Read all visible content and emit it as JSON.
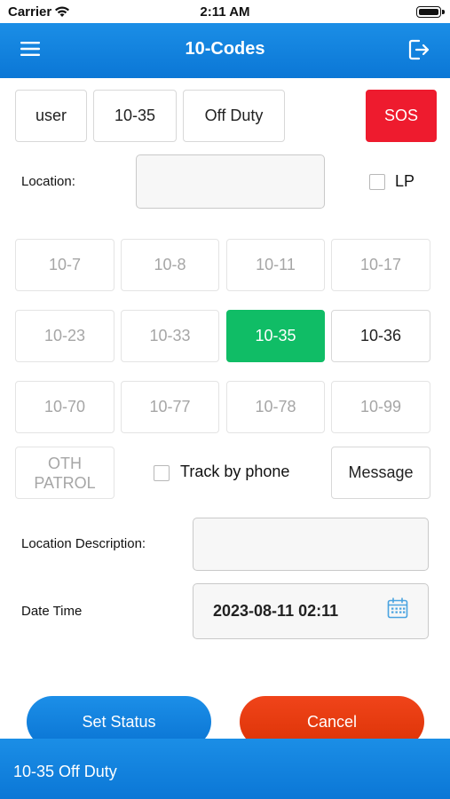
{
  "status_bar": {
    "carrier": "Carrier",
    "time": "2:11 AM"
  },
  "header": {
    "title": "10-Codes"
  },
  "top_row": {
    "user": "user",
    "code": "10-35",
    "duty": "Off Duty",
    "sos": "SOS"
  },
  "location": {
    "label": "Location:",
    "value": "",
    "lp_label": "LP",
    "lp_checked": false
  },
  "codes": [
    "10-7",
    "10-8",
    "10-11",
    "10-17",
    "10-23",
    "10-33",
    "10-35",
    "10-36",
    "10-70",
    "10-77",
    "10-78",
    "10-99"
  ],
  "selected_code": "10-35",
  "extra": {
    "oth_line1": "OTH",
    "oth_line2": "PATROL",
    "track_label": "Track by phone",
    "track_checked": false,
    "message": "Message"
  },
  "location_description": {
    "label": "Location Description:",
    "value": ""
  },
  "date_time": {
    "label": "Date Time",
    "value": "2023-08-11 02:11"
  },
  "actions": {
    "set_status": "Set Status",
    "cancel": "Cancel"
  },
  "colors": {
    "header": "#0b77d6",
    "active": "#10bd66",
    "sos": "#ee1b2e",
    "cancel": "#e23a0a"
  },
  "footer": {
    "status_text": "10-35 Off Duty"
  }
}
